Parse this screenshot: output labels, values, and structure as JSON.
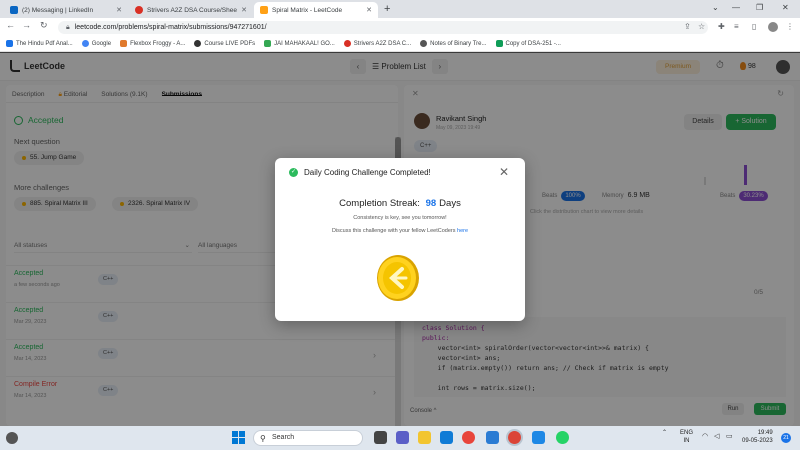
{
  "browser": {
    "tabs": [
      {
        "title": "(2) Messaging | LinkedIn",
        "favicon_color": "#0a66c2",
        "active": false
      },
      {
        "title": "Strivers A2Z DSA Course/Sheet",
        "favicon_color": "#d93025",
        "active": false
      },
      {
        "title": "Spiral Matrix - LeetCode",
        "favicon_color": "#ffa116",
        "active": true
      }
    ],
    "new_tab_icon": "+",
    "url": "leetcode.com/problems/spiral-matrix/submissions/947271601/",
    "bookmarks": [
      {
        "label": "The Hindu Pdf Anal...",
        "color": "#1a73e8"
      },
      {
        "label": "Google",
        "color": "#4285f4"
      },
      {
        "label": "Flexbox Froggy - A...",
        "color": "#e07a2d"
      },
      {
        "label": "Course LIVE PDFs",
        "color": "#333333"
      },
      {
        "label": "JAI MAHAKAAL! GO...",
        "color": "#34a853"
      },
      {
        "label": "Strivers A2Z DSA C...",
        "color": "#d93025"
      },
      {
        "label": "Notes of Binary Tre...",
        "color": "#555555"
      },
      {
        "label": "Copy of DSA-251 -...",
        "color": "#0f9d58"
      }
    ]
  },
  "leetcode": {
    "logo": "LeetCode",
    "problem_list": "Problem List",
    "premium": "Premium",
    "streak_count": "98"
  },
  "left_panel": {
    "tabs": [
      "Description",
      "Editorial",
      "Solutions (9.1K)",
      "Submissions"
    ],
    "status": "Accepted",
    "next_question_label": "Next question",
    "next_question": "55. Jump Game",
    "more_challenges_label": "More challenges",
    "more_challenges": [
      "885. Spiral Matrix III",
      "2326. Spiral Matrix IV"
    ],
    "filter_status": "All statuses",
    "filter_lang": "All languages",
    "submissions": [
      {
        "status": "Accepted",
        "date": "a few seconds ago",
        "lang": "C++",
        "color": "#2cbb5d"
      },
      {
        "status": "Accepted",
        "date": "Mar 29, 2023",
        "lang": "C++",
        "color": "#2cbb5d"
      },
      {
        "status": "Accepted",
        "date": "Mar 14, 2023",
        "lang": "C++",
        "color": "#2cbb5d"
      },
      {
        "status": "Compile Error",
        "date": "Mar 14, 2023",
        "lang": "C++",
        "color": "#ef4743"
      }
    ]
  },
  "right_panel": {
    "user": "Ravikant Singh",
    "date": "May 09, 2023 19:49",
    "details": "Details",
    "solution": "+ Solution",
    "lang": "C++",
    "beats_label": "Beats",
    "runtime_beats": "100%",
    "memory_label": "Memory",
    "memory_value": "6.9 MB",
    "memory_beats": "30.23%",
    "distribution_hint": "Click the distribution chart to view more details",
    "pager": "0/5",
    "code": [
      "class Solution {",
      "public:",
      "    vector<int> spiralOrder(vector<vector<int>>& matrix) {",
      "    vector<int> ans;",
      "    if (matrix.empty()) return ans; // Check if matrix is empty",
      "",
      "    int rows = matrix.size();"
    ],
    "console": "Console ^",
    "run": "Run",
    "submit": "Submit"
  },
  "modal": {
    "title": "Daily Coding Challenge Completed!",
    "streak_label": "Completion Streak:",
    "streak_value": "98",
    "streak_unit": "Days",
    "line1": "Consistency is key, see you tomorrow!",
    "line2": "Discuss this challenge with your fellow LeetCoders",
    "link": "here"
  },
  "taskbar": {
    "search": "Search",
    "lang_top": "ENG",
    "lang_bottom": "IN",
    "time": "19:49",
    "date": "09-05-2023",
    "notifications": "21"
  }
}
